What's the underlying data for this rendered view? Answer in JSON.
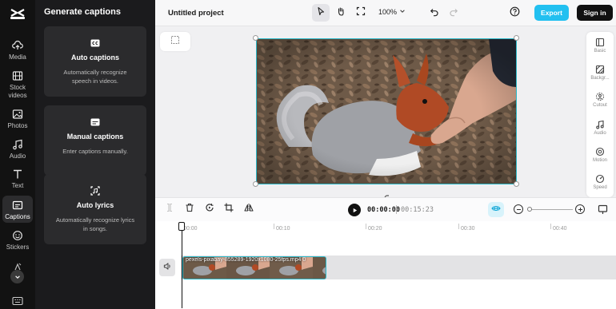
{
  "rail": {
    "items": [
      {
        "label": "Media",
        "icon": "cloud-upload-icon"
      },
      {
        "label": "Stock videos",
        "icon": "film-icon"
      },
      {
        "label": "Photos",
        "icon": "image-icon"
      },
      {
        "label": "Audio",
        "icon": "music-note-icon"
      },
      {
        "label": "Text",
        "icon": "text-icon"
      },
      {
        "label": "Captions",
        "icon": "captions-icon"
      },
      {
        "label": "Stickers",
        "icon": "sticker-icon"
      }
    ]
  },
  "panel": {
    "title": "Generate captions",
    "cards": [
      {
        "title": "Auto captions",
        "desc": "Automatically recognize speech in videos.",
        "icon": "cc-icon"
      },
      {
        "title": "Manual captions",
        "desc": "Enter captions manually.",
        "icon": "subtitle-icon"
      },
      {
        "title": "Auto lyrics",
        "desc": "Automatically recognize lyrics in songs.",
        "icon": "lyrics-icon"
      }
    ]
  },
  "header": {
    "project_title": "Untitled project",
    "zoom": "100%",
    "export_label": "Export",
    "signin_label": "Sign in"
  },
  "properties": [
    {
      "label": "Basic",
      "icon": "basic-icon"
    },
    {
      "label": "Backgr...",
      "icon": "background-icon"
    },
    {
      "label": "Cutout",
      "icon": "cutout-icon"
    },
    {
      "label": "Audio",
      "icon": "audio-icon"
    },
    {
      "label": "Motion",
      "icon": "motion-icon"
    },
    {
      "label": "Speed",
      "icon": "speed-icon"
    }
  ],
  "playback": {
    "current_time": "00:00:00",
    "total_time": "00:15:23"
  },
  "timeline": {
    "ruler": [
      "00:00",
      "00:10",
      "00:20",
      "00:30",
      "00:40"
    ],
    "clip_name": "pexels-pixabay-855289-1920x1080-25fps.mp4",
    "clip_duration_mark": "0"
  },
  "colors": {
    "accent": "#22c0f0",
    "selection": "#2ab8c8",
    "dark_panel": "#1b1b1d"
  }
}
